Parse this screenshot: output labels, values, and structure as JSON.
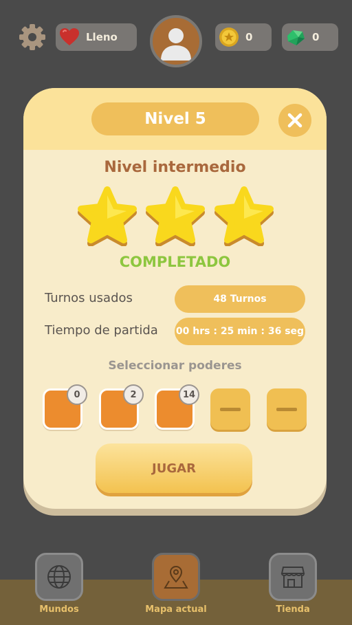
{
  "topbar": {
    "settings_icon": "gear-icon",
    "lives_label": "Lleno",
    "lives_icon": "heart-icon",
    "avatar_icon": "user-avatar-icon",
    "coins_value": "0",
    "coins_icon": "coin-icon",
    "gems_value": "0",
    "gems_icon": "gem-icon"
  },
  "modal": {
    "title": "Nivel 5",
    "close_icon": "close-icon",
    "subtitle": "Nivel intermedio",
    "stars_earned": 3,
    "stars_total": 3,
    "status": "COMPLETADO",
    "stats": [
      {
        "label": "Turnos usados",
        "value": "48 Turnos"
      },
      {
        "label": "Tiempo de partida",
        "value": "00 hrs : 25 min : 36 seg"
      }
    ],
    "powers_title": "Seleccionar poderes",
    "powers": [
      {
        "count": "0",
        "locked": false
      },
      {
        "count": "2",
        "locked": false
      },
      {
        "count": "14",
        "locked": false
      },
      {
        "count": null,
        "locked": true
      },
      {
        "count": null,
        "locked": true
      }
    ],
    "play_label": "JUGAR"
  },
  "bottom_nav": [
    {
      "label": "Mundos",
      "icon": "globe-icon",
      "active": false
    },
    {
      "label": "Mapa actual",
      "icon": "map-pin-icon",
      "active": true
    },
    {
      "label": "Tienda",
      "icon": "store-icon",
      "active": false
    }
  ],
  "colors": {
    "background": "#4a4a4a",
    "modal": "#f8ecca",
    "accent": "#efbf5b",
    "completed": "#8dc63f",
    "subtitle": "#a9683d"
  }
}
